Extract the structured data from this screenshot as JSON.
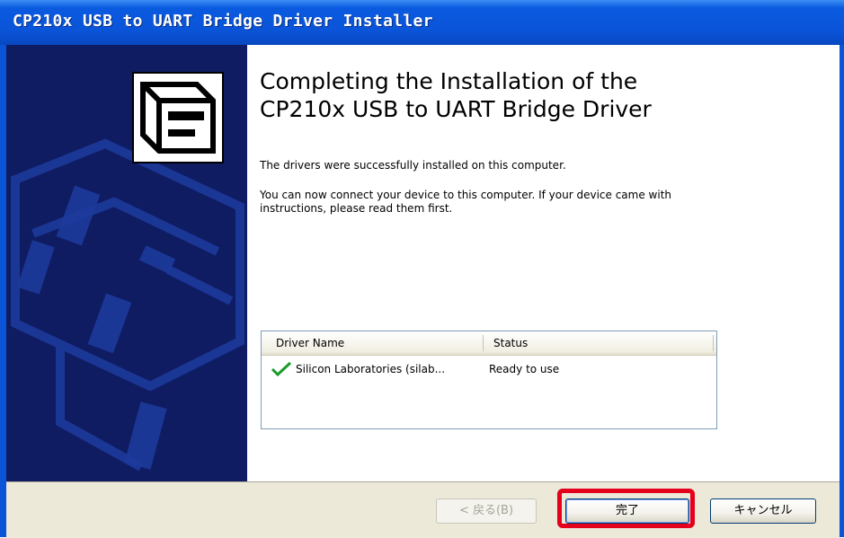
{
  "window": {
    "title": "CP210x USB to UART Bridge Driver Installer"
  },
  "content": {
    "heading_line1": "Completing the Installation of the",
    "heading_line2": "CP210x USB to UART Bridge Driver",
    "message1": "The drivers were successfully installed on this computer.",
    "message2": "You can now connect your device to this computer. If your device came with instructions, please read them first."
  },
  "driver_list": {
    "columns": [
      "Driver Name",
      "Status"
    ],
    "rows": [
      {
        "name": "Silicon Laboratories (silab...",
        "status": "Ready to use",
        "icon": "green-check-icon"
      }
    ]
  },
  "buttons": {
    "back": "< 戻る(B)",
    "finish": "完了",
    "cancel": "キャンセル"
  },
  "colors": {
    "titlebar": "#0a54d8",
    "side_panel": "#101c62",
    "highlight": "#e4001c",
    "check": "#1a9a2a"
  }
}
